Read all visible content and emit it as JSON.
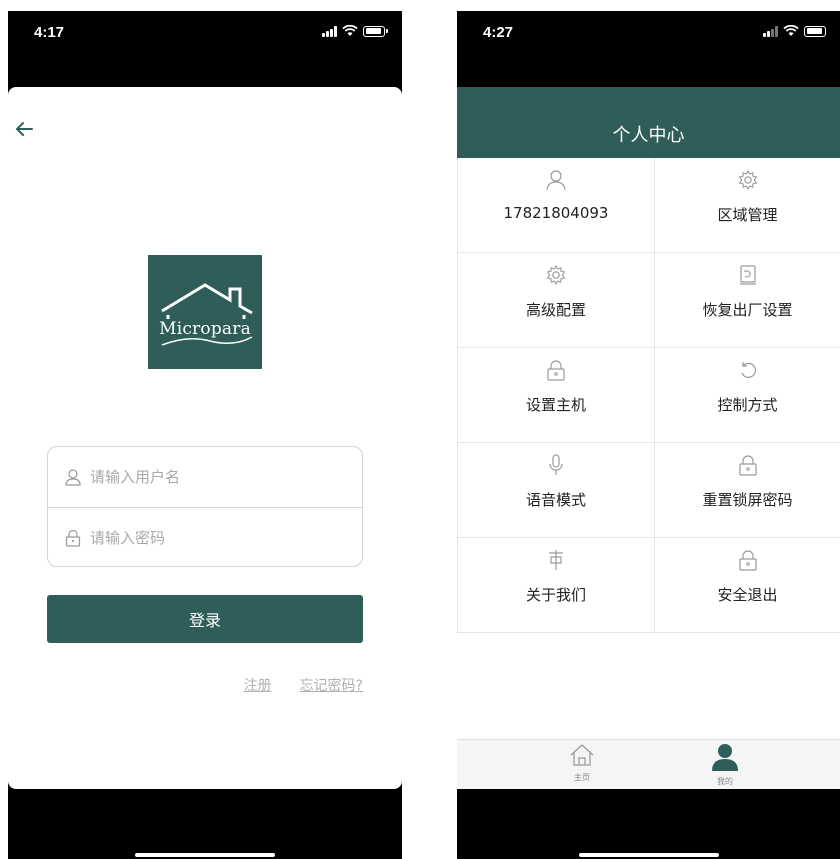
{
  "login_screen": {
    "status_time": "4:17",
    "logo_text": "Micropara",
    "username_placeholder": "请输入用户名",
    "password_placeholder": "请输入密码",
    "login_label": "登录",
    "register_label": "注册",
    "forgot_label": "忘记密码?"
  },
  "profile_screen": {
    "status_time": "4:27",
    "header_title": "个人中心",
    "grid": [
      [
        "17821804093",
        "区域管理"
      ],
      [
        "高级配置",
        "恢复出厂设置"
      ],
      [
        "设置主机",
        "控制方式"
      ],
      [
        "语音模式",
        "重置锁屏密码"
      ],
      [
        "关于我们",
        "安全退出"
      ]
    ],
    "tabs": {
      "home_label": "主页",
      "mine_label": "我的"
    }
  },
  "colors": {
    "brand": "#2f5e5a",
    "icon_gray": "#9a9a9a",
    "link_gray": "#b0b0b0"
  }
}
